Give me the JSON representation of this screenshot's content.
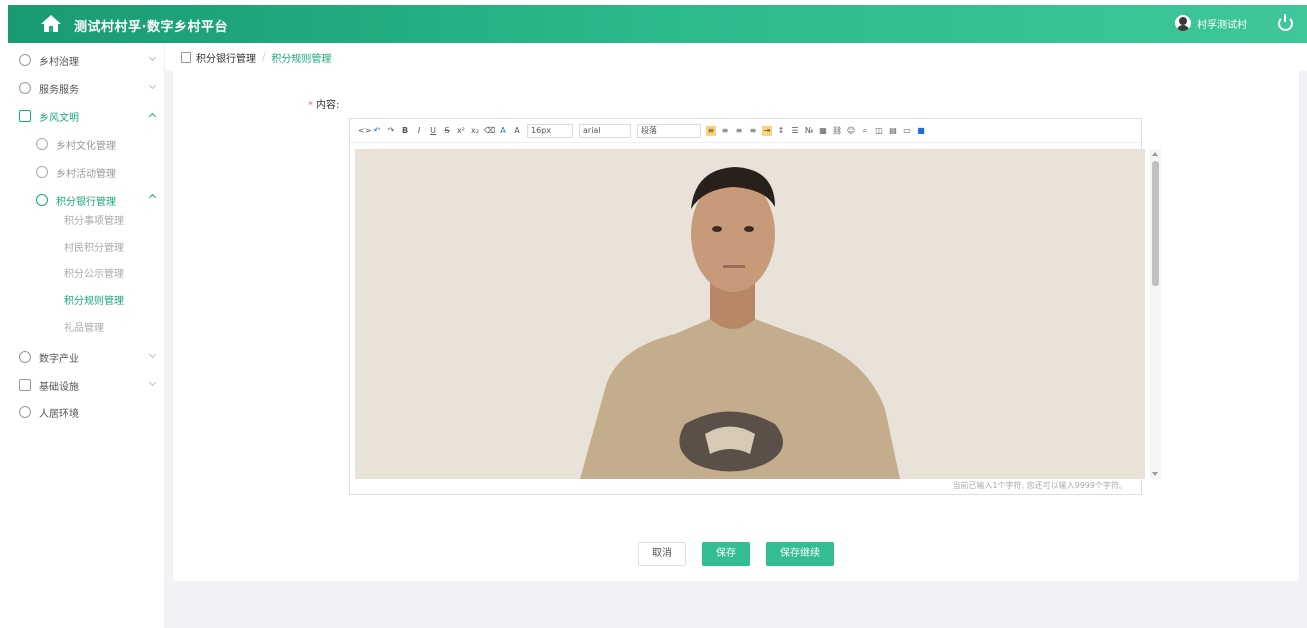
{
  "header": {
    "title": "测试村村孚·数字乡村平台",
    "user_name": "村孚测试村"
  },
  "sidebar": {
    "items": [
      {
        "label": "乡村治理"
      },
      {
        "label": "服务服务"
      },
      {
        "label": "乡风文明"
      },
      {
        "label": "数字产业"
      },
      {
        "label": "基础设施"
      },
      {
        "label": "人居环境"
      }
    ],
    "sub_items": [
      {
        "label": "乡村文化管理"
      },
      {
        "label": "乡村活动管理"
      },
      {
        "label": "积分银行管理"
      }
    ],
    "leaf_items": [
      {
        "label": "积分事项管理"
      },
      {
        "label": "村民积分管理"
      },
      {
        "label": "积分公示管理"
      },
      {
        "label": "积分规则管理"
      },
      {
        "label": "礼品管理"
      }
    ]
  },
  "breadcrumb": {
    "parent": "积分银行管理",
    "current": "积分规则管理"
  },
  "form": {
    "content_label": "内容:"
  },
  "editor": {
    "font_size": "16px",
    "font_family": "arial",
    "paragraph": "段落",
    "word_count": "当前已输入1个字符, 您还可以输入9999个字符。"
  },
  "actions": {
    "cancel": "取消",
    "save": "保存",
    "save_continue": "保存继续"
  },
  "colors": {
    "accent": "#1aa97c",
    "header_start": "#199a72",
    "header_end": "#3fc79a"
  }
}
